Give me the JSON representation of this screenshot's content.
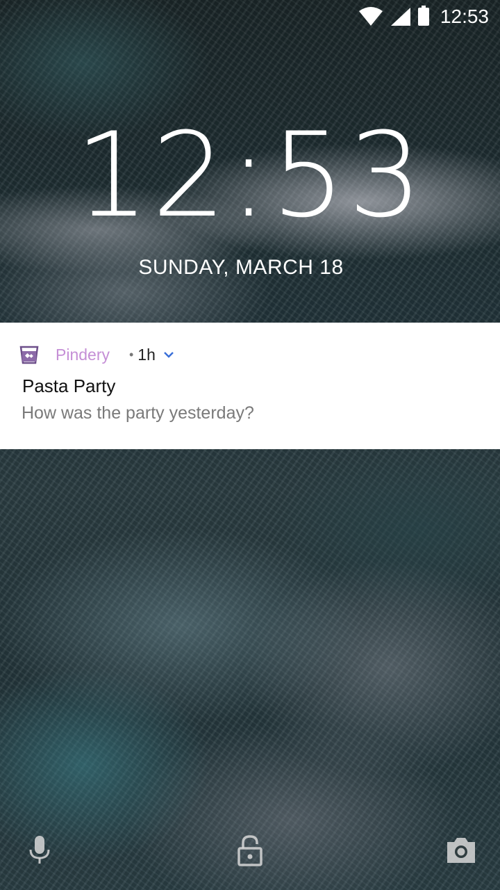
{
  "status_bar": {
    "time": "12:53",
    "icons": [
      "wifi-icon",
      "cell-signal-icon",
      "battery-icon"
    ]
  },
  "lockscreen": {
    "clock": "12:53",
    "date": "SUNDAY, MARCH 18"
  },
  "notification": {
    "app_name": "Pindery",
    "separator": "•",
    "age": "1h",
    "title": "Pasta Party",
    "body": "How was the party yesterday?",
    "app_color": "#c58fd6",
    "expand_icon": "chevron-down-icon"
  },
  "bottom_actions": {
    "left": "mic-icon",
    "center": "lock-icon",
    "right": "camera-icon"
  }
}
